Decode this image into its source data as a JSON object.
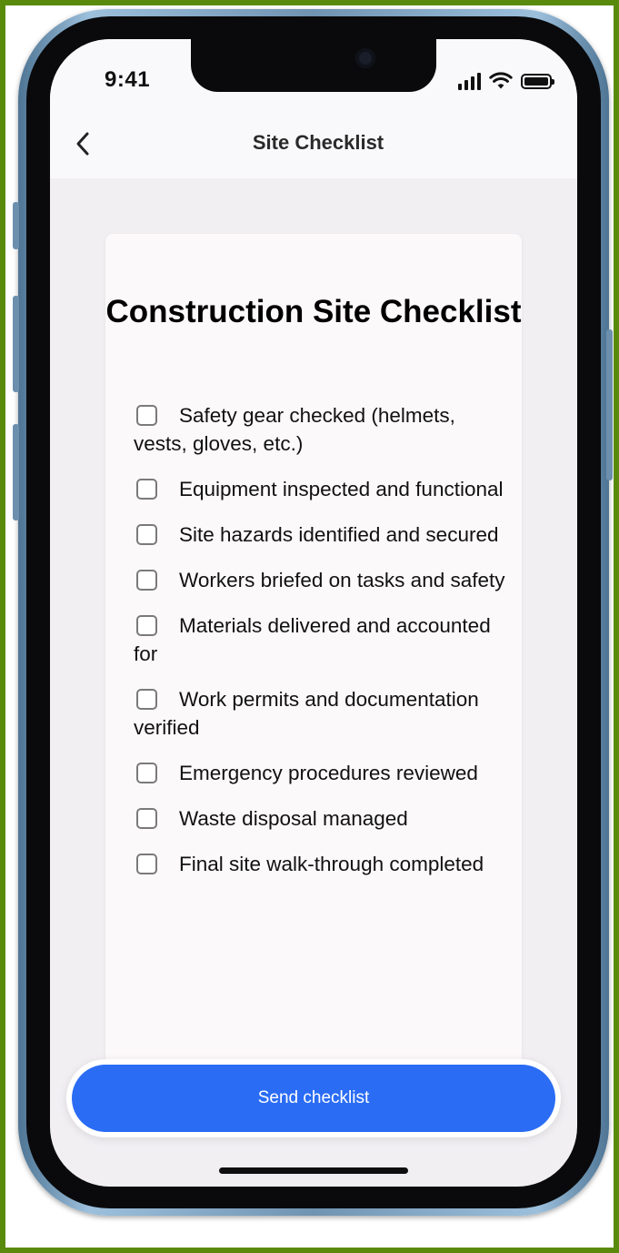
{
  "status_bar": {
    "time": "9:41",
    "icons": [
      "cellular-signal-icon",
      "wifi-icon",
      "battery-icon"
    ]
  },
  "nav": {
    "back_icon": "chevron-left-icon",
    "title": "Site Checklist"
  },
  "card": {
    "title": "Construction Site Checklist",
    "items": [
      {
        "label": "Safety gear checked (helmets, vests, gloves, etc.)",
        "checked": false
      },
      {
        "label": "Equipment inspected and functional",
        "checked": false
      },
      {
        "label": "Site hazards identified and secured",
        "checked": false
      },
      {
        "label": "Workers briefed on tasks and safety",
        "checked": false
      },
      {
        "label": "Materials delivered and accounted for",
        "checked": false
      },
      {
        "label": "Work permits and documentation verified",
        "checked": false
      },
      {
        "label": "Emergency procedures reviewed",
        "checked": false
      },
      {
        "label": "Waste disposal managed",
        "checked": false
      },
      {
        "label": "Final site walk-through completed",
        "checked": false
      }
    ]
  },
  "footer": {
    "send_label": "Send checklist"
  },
  "colors": {
    "accent": "#2a6cf4",
    "screen_bg": "#f1eff2",
    "card_bg": "#fcf9fb",
    "frame_border": "#5a8a0c"
  }
}
